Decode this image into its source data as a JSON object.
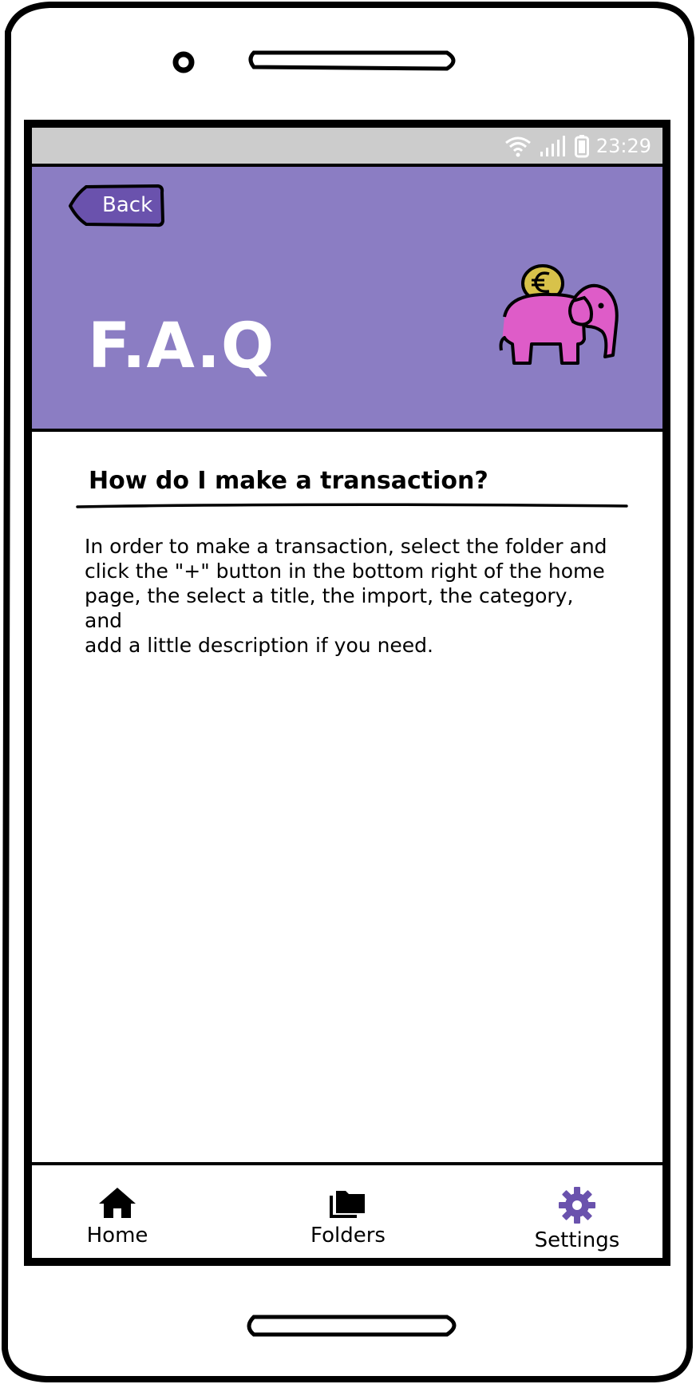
{
  "status_bar": {
    "time": "23:29"
  },
  "header": {
    "back_label": "Back",
    "title": "F.A.Q",
    "background_color": "#8b7dc3",
    "logo_icon": "piggy-bank-elephant-euro-icon"
  },
  "faq": {
    "question": "How do I make a transaction?",
    "answer_lines": [
      "In order to make a transaction, select the folder and",
      "click the \"+\" button in the bottom right of the home",
      "page, the select a title, the import, the category, and",
      "add a little description if you need."
    ]
  },
  "nav": {
    "home_label": "Home",
    "folders_label": "Folders",
    "settings_label": "Settings",
    "active_item": "Settings",
    "active_color": "#6a52ad"
  }
}
